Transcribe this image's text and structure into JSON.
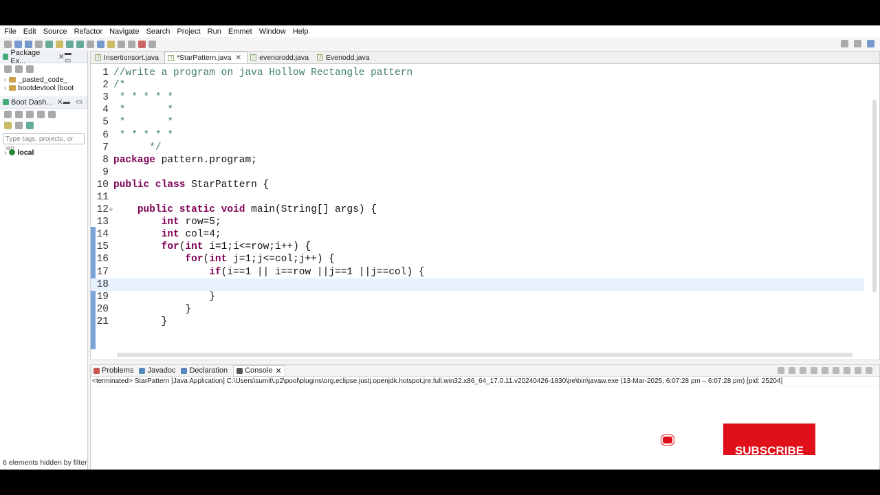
{
  "menu": [
    "File",
    "Edit",
    "Source",
    "Refactor",
    "Navigate",
    "Search",
    "Project",
    "Run",
    "Emmet",
    "Window",
    "Help"
  ],
  "left": {
    "package_explorer_tab": "Package Ex...",
    "tree": [
      "_pasted_code_",
      "bootdevtool [boot"
    ],
    "boot_dash_tab": "Boot Dash...",
    "filter_placeholder": "Type tags, projects, or wo",
    "local_label": "local",
    "status": "6 elements hidden by filter"
  },
  "editor": {
    "tabs": [
      {
        "label": "Insertionsort.java",
        "active": false
      },
      {
        "label": "*StarPattern.java",
        "active": true
      },
      {
        "label": "evenorodd.java",
        "active": false
      },
      {
        "label": "Evenodd.java",
        "active": false
      }
    ],
    "lines": [
      {
        "n": "1",
        "text": "//write a program on java Hollow Rectangle pattern"
      },
      {
        "n": "2",
        "text": "/*"
      },
      {
        "n": "3",
        "text": " * * * * *"
      },
      {
        "n": "4",
        "text": " *       *"
      },
      {
        "n": "5",
        "text": " *       *"
      },
      {
        "n": "6",
        "text": " * * * * *"
      },
      {
        "n": "7",
        "text": "      */"
      },
      {
        "n": "8",
        "text": "package pattern.program;"
      },
      {
        "n": "9",
        "text": ""
      },
      {
        "n": "10",
        "text": "public class StarPattern {"
      },
      {
        "n": "11",
        "text": ""
      },
      {
        "n": "12",
        "text": "    public static void main(String[] args) {"
      },
      {
        "n": "13",
        "text": "        int row=5;"
      },
      {
        "n": "14",
        "text": "        int col=4;"
      },
      {
        "n": "15",
        "text": "        for(int i=1;i<=row;i++) {"
      },
      {
        "n": "16",
        "text": "            for(int j=1;j<=col;j++) {"
      },
      {
        "n": "17",
        "text": "                if(i==1 || i==row ||j==1 ||j==col) {"
      },
      {
        "n": "18",
        "text": ""
      },
      {
        "n": "19",
        "text": "                }"
      },
      {
        "n": "20",
        "text": "            }"
      },
      {
        "n": "21",
        "text": "        }"
      }
    ],
    "current_line": "18"
  },
  "console": {
    "tabs": [
      "Problems",
      "Javadoc",
      "Declaration",
      "Console"
    ],
    "info": "<terminated> StarPattern [Java Application] C:\\Users\\sumit\\.p2\\pool\\plugins\\org.eclipse.justj.openjdk.hotspot.jre.full.win32.x86_64_17.0.11.v20240426-1830\\jre\\bin\\javaw.exe  (13-Mar-2025, 6:07:28 pm – 6:07:28 pm) [pid: 25204]",
    "subscribe_label": "SUBSCRIBE"
  },
  "colors": {
    "keyword": "#7f0055",
    "comment": "#3f7f5f",
    "accent": "#e0101a"
  }
}
